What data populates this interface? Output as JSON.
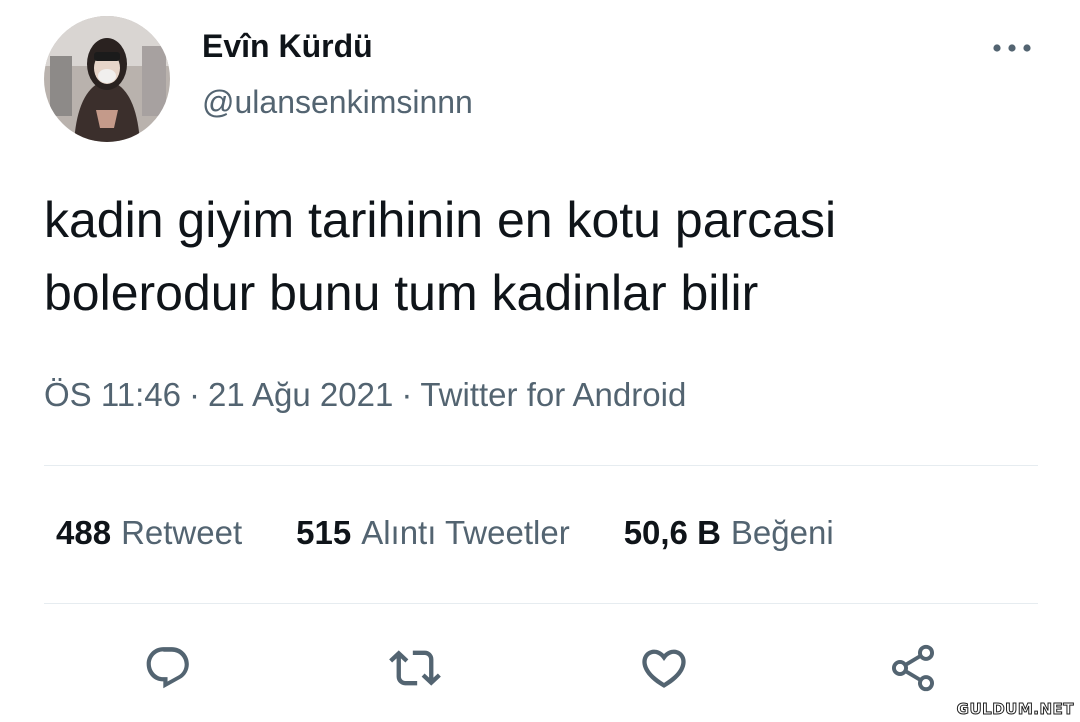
{
  "tweet": {
    "author": {
      "display_name": "Evîn Kürdü",
      "handle": "@ulansenkimsinnn"
    },
    "text": "kadin giyim tarihinin en kotu parcasi bolerodur bunu tum kadinlar bilir",
    "time": "ÖS 11:46",
    "date": "21 Ağu 2021",
    "source": "Twitter for Android",
    "separator": "·"
  },
  "stats": [
    {
      "value": "488",
      "label": "Retweet"
    },
    {
      "value": "515",
      "label": "Alıntı Tweetler"
    },
    {
      "value": "50,6 B",
      "label": "Beğeni"
    }
  ],
  "icons": {
    "more": "more-horizontal-icon",
    "reply": "reply-icon",
    "retweet": "retweet-icon",
    "like": "heart-icon",
    "share": "share-icon"
  },
  "colors": {
    "text_primary": "#0f1419",
    "text_secondary": "#536471",
    "divider": "#e6ecf0"
  },
  "watermark": "GULDUM.NET"
}
